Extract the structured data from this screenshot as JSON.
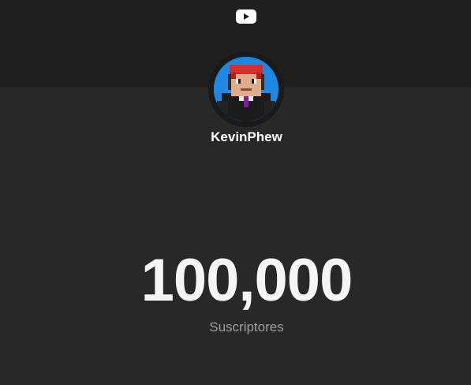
{
  "header": {
    "logo_icon": "youtube-play-icon",
    "logo_color": "#ffffff"
  },
  "channel": {
    "name": "KevinPhew",
    "avatar_icon": "minecraft-skin-avatar",
    "avatar_bg": "#1e88e5"
  },
  "stats": {
    "subscriber_count": "100,000",
    "subscriber_label": "Suscriptores"
  },
  "colors": {
    "background": "#282828",
    "header_band": "#1f1f1f",
    "label": "#9e9e9e"
  }
}
